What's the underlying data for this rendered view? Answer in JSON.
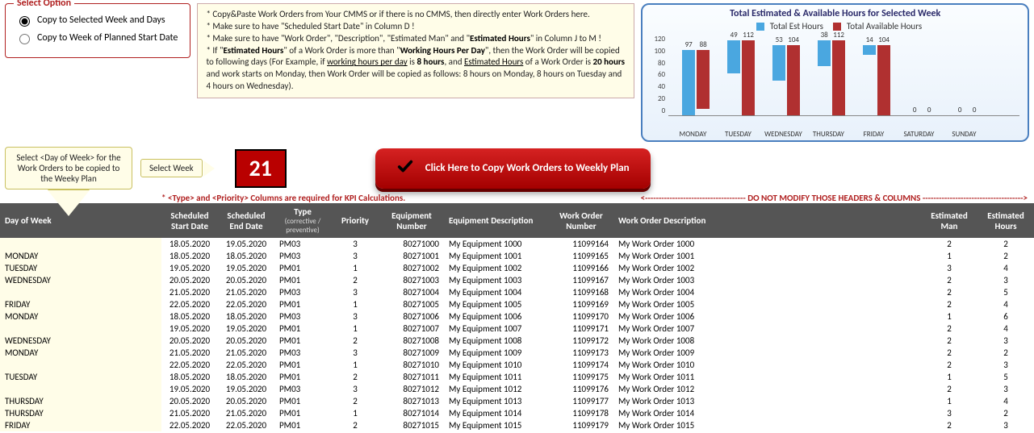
{
  "select_option": {
    "title": "Select Option",
    "opt1": "Copy to Selected Week and Days",
    "opt2": "Copy to Week of Planned Start Date"
  },
  "info_lines": [
    "* Copy&Paste Work Orders from Your CMMS or if there is no CMMS, then directly enter Work Orders here.",
    "* Make sure to have \"Scheduled Start Date\" in Column D !",
    "* Make sure to have \"Work Order\", \"Description\", \"Estimated Man\" and \"Estimated Hours\" in Column J to M !",
    "* If \"Estimated Hours\" of a Work Order is more than \"Working Hours Per Day\", then the Work Order will be copied to following days (For Example, if working hours per day is 8 hours, and Estimated Hours of a Work Order is 20 hours and work starts on Monday, then Work Order will be copied as follows: 8 hours on Monday, 8 hours on Tuesday and 4 hours on Wednesday)."
  ],
  "select_day_hint": "Select <Day of Week> for the Work Orders to be copied to the Weeky Plan",
  "select_week_label": "Select Week",
  "week_number": "21",
  "copy_button": "Click Here to Copy Work Orders to Weekly Plan",
  "warn_left": "* <Type> and <Priority> Columns are required for KPI Calculations.",
  "warn_right": "<------------------------------------- DO NOT MODIFY THOSE HEADERS & COLUMNS ------------------------------------->",
  "chart_data": {
    "type": "bar",
    "title": "Total Estimated & Available Hours for Selected Week",
    "legend": [
      "Total Est Hours",
      "Total Available Hours"
    ],
    "categories": [
      "MONDAY",
      "TUESDAY",
      "WEDNESDAY",
      "THURSDAY",
      "FRIDAY",
      "SATURDAY",
      "SUNDAY"
    ],
    "series": [
      {
        "name": "Total Est Hours",
        "values": [
          97,
          49,
          53,
          38,
          14,
          0,
          0
        ]
      },
      {
        "name": "Total Available Hours",
        "values": [
          88,
          112,
          104,
          112,
          104,
          0,
          0
        ]
      }
    ],
    "ylim": [
      0,
      120
    ],
    "yticks": [
      0,
      20,
      40,
      60,
      80,
      100,
      120
    ]
  },
  "columns": {
    "dow": "Day of Week",
    "sstart": "Scheduled Start Date",
    "send": "Scheduled End Date",
    "type": "Type",
    "type_sub": "(corrective / preventive)",
    "prio": "Priority",
    "eqnum": "Equipment Number",
    "eqdesc": "Equipment Description",
    "wonum": "Work Order Number",
    "wodesc": "Work Order Description",
    "eman": "Estimated Man",
    "ehours": "Estimated Hours"
  },
  "rows": [
    {
      "dow": "",
      "sstart": "18.05.2020",
      "send": "19.05.2020",
      "type": "PM03",
      "prio": 3,
      "eqnum": "80271000",
      "eqdesc": "My Equipment 1000",
      "wonum": "11099164",
      "wodesc": "My Work Order 1000",
      "eman": 2,
      "ehours": 2
    },
    {
      "dow": "MONDAY",
      "sstart": "18.05.2020",
      "send": "18.05.2020",
      "type": "PM03",
      "prio": 3,
      "eqnum": "80271001",
      "eqdesc": "My Equipment 1001",
      "wonum": "11099165",
      "wodesc": "My Work Order 1001",
      "eman": 1,
      "ehours": 2
    },
    {
      "dow": "TUESDAY",
      "sstart": "19.05.2020",
      "send": "19.05.2020",
      "type": "PM01",
      "prio": 1,
      "eqnum": "80271002",
      "eqdesc": "My Equipment 1002",
      "wonum": "11099166",
      "wodesc": "My Work Order 1002",
      "eman": 3,
      "ehours": 4
    },
    {
      "dow": "WEDNESDAY",
      "sstart": "20.05.2020",
      "send": "20.05.2020",
      "type": "PM01",
      "prio": 2,
      "eqnum": "80271003",
      "eqdesc": "My Equipment 1003",
      "wonum": "11099167",
      "wodesc": "My Work Order 1003",
      "eman": 2,
      "ehours": 3
    },
    {
      "dow": "",
      "sstart": "21.05.2020",
      "send": "21.05.2020",
      "type": "PM03",
      "prio": 3,
      "eqnum": "80271004",
      "eqdesc": "My Equipment 1004",
      "wonum": "11099168",
      "wodesc": "My Work Order 1004",
      "eman": 2,
      "ehours": 5
    },
    {
      "dow": "FRIDAY",
      "sstart": "22.05.2020",
      "send": "22.05.2020",
      "type": "PM01",
      "prio": 1,
      "eqnum": "80271005",
      "eqdesc": "My Equipment 1005",
      "wonum": "11099169",
      "wodesc": "My Work Order 1005",
      "eman": 2,
      "ehours": 4
    },
    {
      "dow": "MONDAY",
      "sstart": "18.05.2020",
      "send": "18.05.2020",
      "type": "PM03",
      "prio": 3,
      "eqnum": "80271006",
      "eqdesc": "My Equipment 1006",
      "wonum": "11099170",
      "wodesc": "My Work Order 1006",
      "eman": 1,
      "ehours": 6
    },
    {
      "dow": "",
      "sstart": "19.05.2020",
      "send": "19.05.2020",
      "type": "PM01",
      "prio": 1,
      "eqnum": "80271007",
      "eqdesc": "My Equipment 1007",
      "wonum": "11099171",
      "wodesc": "My Work Order 1007",
      "eman": 2,
      "ehours": 4
    },
    {
      "dow": "WEDNESDAY",
      "sstart": "20.05.2020",
      "send": "20.05.2020",
      "type": "PM01",
      "prio": 2,
      "eqnum": "80271008",
      "eqdesc": "My Equipment 1008",
      "wonum": "11099172",
      "wodesc": "My Work Order 1008",
      "eman": 2,
      "ehours": 3
    },
    {
      "dow": "MONDAY",
      "sstart": "21.05.2020",
      "send": "21.05.2020",
      "type": "PM03",
      "prio": 3,
      "eqnum": "80271009",
      "eqdesc": "My Equipment 1009",
      "wonum": "11099173",
      "wodesc": "My Work Order 1009",
      "eman": 2,
      "ehours": 2
    },
    {
      "dow": "",
      "sstart": "22.05.2020",
      "send": "22.05.2020",
      "type": "PM01",
      "prio": 1,
      "eqnum": "80271010",
      "eqdesc": "My Equipment 1010",
      "wonum": "11099174",
      "wodesc": "My Work Order 1010",
      "eman": 2,
      "ehours": 3
    },
    {
      "dow": "TUESDAY",
      "sstart": "18.05.2020",
      "send": "18.05.2020",
      "type": "PM01",
      "prio": 2,
      "eqnum": "80271011",
      "eqdesc": "My Equipment 1011",
      "wonum": "11099175",
      "wodesc": "My Work Order 1011",
      "eman": 1,
      "ehours": 5
    },
    {
      "dow": "",
      "sstart": "19.05.2020",
      "send": "19.05.2020",
      "type": "PM03",
      "prio": 3,
      "eqnum": "80271012",
      "eqdesc": "My Equipment 1012",
      "wonum": "11099176",
      "wodesc": "My Work Order 1012",
      "eman": 2,
      "ehours": 3
    },
    {
      "dow": "THURSDAY",
      "sstart": "20.05.2020",
      "send": "20.05.2020",
      "type": "PM01",
      "prio": 2,
      "eqnum": "80271013",
      "eqdesc": "My Equipment 1013",
      "wonum": "11099177",
      "wodesc": "My Work Order 1013",
      "eman": 1,
      "ehours": 4
    },
    {
      "dow": "THURSDAY",
      "sstart": "21.05.2020",
      "send": "21.05.2020",
      "type": "PM01",
      "prio": 1,
      "eqnum": "80271014",
      "eqdesc": "My Equipment 1014",
      "wonum": "11099178",
      "wodesc": "My Work Order 1014",
      "eman": 3,
      "ehours": 2
    },
    {
      "dow": "FRIDAY",
      "sstart": "22.05.2020",
      "send": "22.05.2020",
      "type": "PM01",
      "prio": 2,
      "eqnum": "80271015",
      "eqdesc": "My Equipment 1015",
      "wonum": "11099179",
      "wodesc": "My Work Order 1015",
      "eman": 2,
      "ehours": 3
    }
  ]
}
